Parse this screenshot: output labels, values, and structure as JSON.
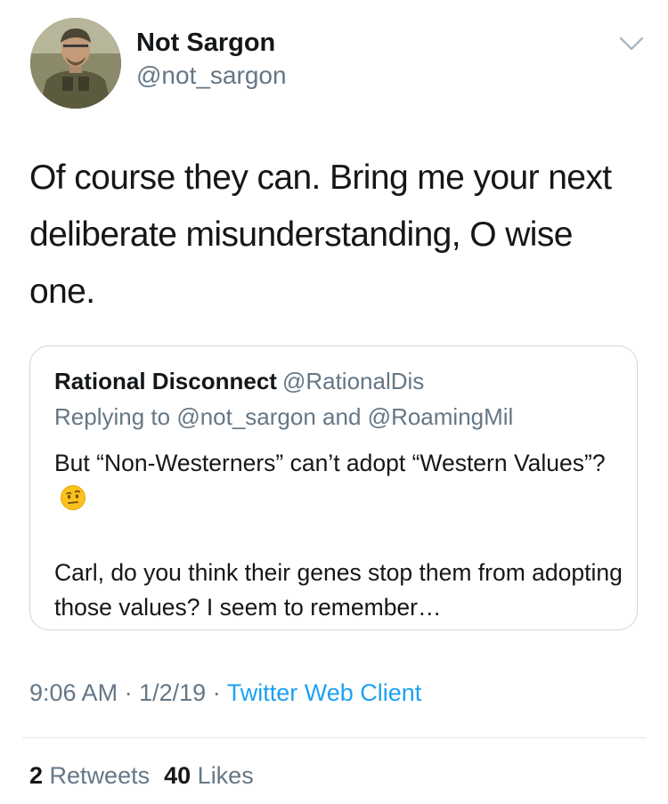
{
  "author": {
    "display_name": "Not Sargon",
    "handle": "@not_sargon",
    "avatar_icon": "soldier-avatar"
  },
  "tweet": {
    "text": "Of course they can. Bring me your next deliberate misunderstanding, O wise one."
  },
  "quoted_tweet": {
    "display_name": "Rational Disconnect",
    "handle": "@RationalDis",
    "reply_prefix": "Replying to",
    "reply_user_1": "@not_sargon",
    "reply_and": "and",
    "reply_user_2": "@RoamingMil",
    "paragraph_1": "But “Non-Westerners” can’t adopt “Western Values”?",
    "emoji": "face-with-raised-eyebrow",
    "paragraph_2": "Carl, do you think their genes stop them from adopting those values? I seem to remember…"
  },
  "meta": {
    "time": "9:06 AM",
    "date": "1/2/19",
    "separator": "·",
    "source": "Twitter Web Client"
  },
  "stats": {
    "retweets_count": "2",
    "retweets_label": "Retweets",
    "likes_count": "40",
    "likes_label": "Likes"
  },
  "colors": {
    "link_blue": "#1da1f2",
    "secondary_gray": "#657786",
    "border": "#ccd6dd"
  }
}
